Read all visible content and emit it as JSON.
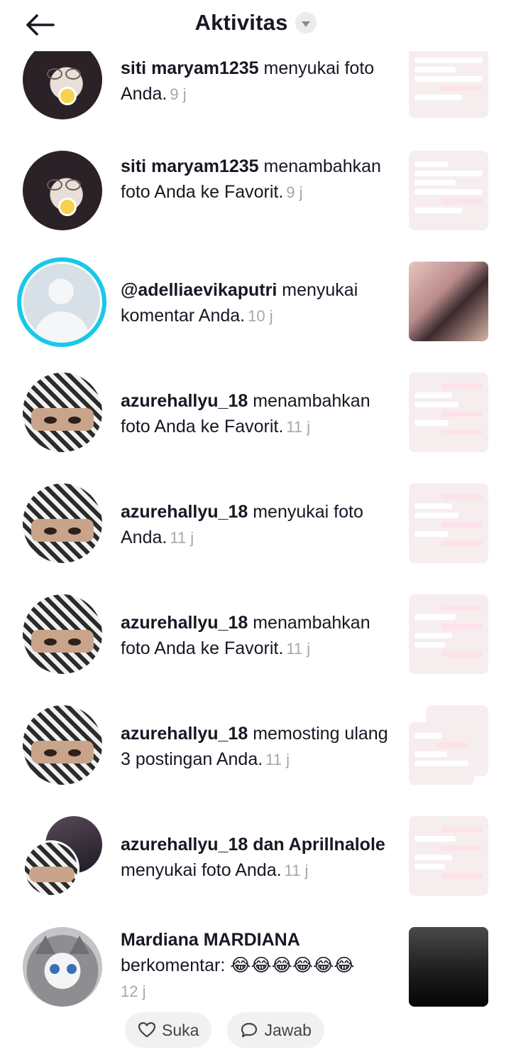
{
  "header": {
    "title": "Aktivitas",
    "back_icon": "arrow-left-icon",
    "filter_icon": "chevron-down-icon"
  },
  "notifications": [
    {
      "user": "siti maryam1235",
      "action": " menyukai foto Anda.",
      "time": "9 j"
    },
    {
      "user": "siti maryam1235",
      "action": " menambahkan foto Anda ke Favorit.",
      "time": "9 j"
    },
    {
      "user": "@adelliaevikaputri",
      "action": " menyukai komentar Anda.",
      "time": "10 j"
    },
    {
      "user": "azurehallyu_18",
      "action": " menambahkan foto Anda ke Favorit.",
      "time": "11 j"
    },
    {
      "user": "azurehallyu_18",
      "action": " menyukai foto Anda.",
      "time": "11 j"
    },
    {
      "user": "azurehallyu_18",
      "action": " menambahkan foto Anda ke Favorit.",
      "time": "11 j"
    },
    {
      "user": "azurehallyu_18",
      "action": " memosting ulang 3 postingan Anda.",
      "time": "11 j"
    },
    {
      "user": "azurehallyu_18 dan Aprillnalole",
      "action": " menyukai foto Anda.",
      "time": "11 j"
    },
    {
      "user": "Mardiana MARDIANA",
      "action": " berkomentar: 😂😂😂😂😂😂",
      "time": "12 j"
    }
  ],
  "comment_actions": {
    "like_label": "Suka",
    "reply_label": "Jawab",
    "like_icon": "heart-icon",
    "reply_icon": "speech-bubble-icon"
  },
  "colors": {
    "accent_ring": "#19c8e8",
    "time_gray": "#a5a7ad",
    "pill_bg": "#f1f1f2"
  }
}
